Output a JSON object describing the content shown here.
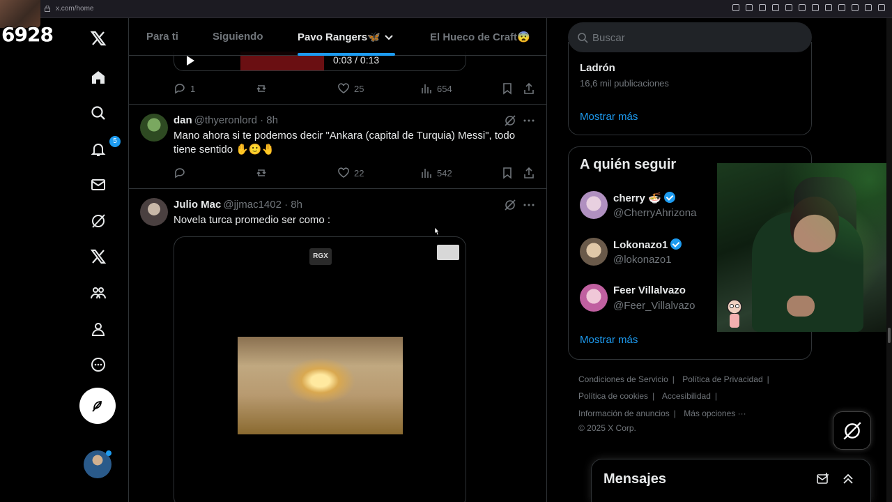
{
  "browser": {
    "url": "x.com/home"
  },
  "overlay": {
    "counter": "6928"
  },
  "nav": {
    "notifications_badge": "5"
  },
  "tabs": [
    {
      "label": "Para ti"
    },
    {
      "label": "Siguiendo"
    },
    {
      "label": "Pavo Rangers🦋"
    },
    {
      "label": "El Hueco de Craft😨"
    }
  ],
  "top_post": {
    "video_time": "0:03 / 0:13",
    "replies": "1",
    "likes": "25",
    "views": "654"
  },
  "tweets": [
    {
      "name": "dan",
      "handle": "@thyeronlord · 8h",
      "text": "Mano ahora si te podemos decir \"Ankara (capital de Turquia) Messi\", todo tiene sentido ✋🙂🤚",
      "replies": "",
      "likes": "22",
      "views": "542"
    },
    {
      "name": "Julio Mac",
      "handle": "@jjmac1402 · 8h",
      "text": "Novela turca promedio ser como :",
      "media_watermark": "RGX"
    }
  ],
  "search": {
    "placeholder": "Buscar"
  },
  "trends": {
    "name": "Ladrón",
    "count": "16,6 mil publicaciones",
    "show_more": "Mostrar más"
  },
  "who_to_follow": {
    "title": "A quién seguir",
    "accounts": [
      {
        "name": "cherry 🍜",
        "handle": "@CherryAhrizona"
      },
      {
        "name": "Lokonazo1",
        "handle": "@lokonazo1"
      },
      {
        "name": "Feer Villalvazo",
        "handle": "@Feer_Villalvazo"
      }
    ],
    "show_more": "Mostrar más"
  },
  "footer": {
    "links": [
      "Condiciones de Servicio",
      "Política de Privacidad",
      "Política de cookies",
      "Accesibilidad",
      "Información de anuncios",
      "Más opciones ···"
    ],
    "copyright": "© 2025 X Corp."
  },
  "messages": {
    "title": "Mensajes"
  },
  "colors": {
    "accent": "#1d9bf0",
    "background": "#000000",
    "muted": "#71767b"
  }
}
